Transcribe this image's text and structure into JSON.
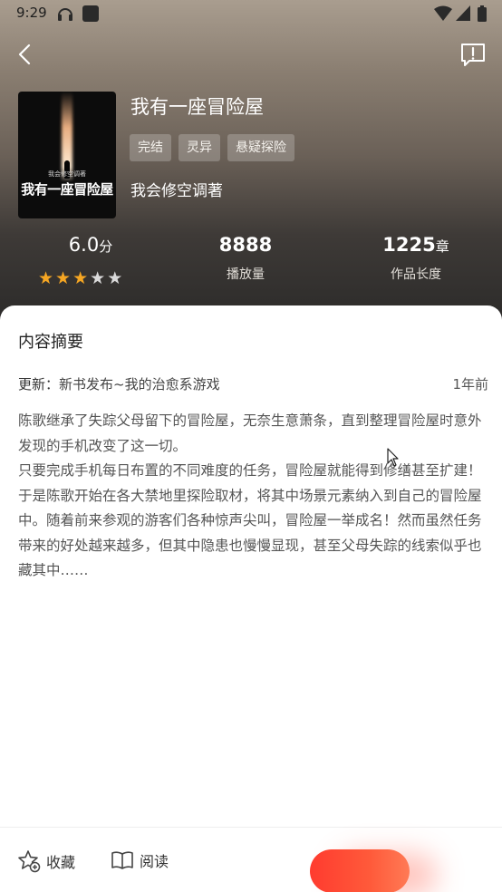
{
  "status_bar": {
    "time": "9:29"
  },
  "book": {
    "cover_small_text": "我会修空调著",
    "cover_title": "我有一座冒险屋",
    "title": "我有一座冒险屋",
    "tags": [
      "完结",
      "灵异",
      "悬疑探险"
    ],
    "author": "我会修空调著"
  },
  "stats": {
    "rating": "6.0",
    "rating_unit": "分",
    "stars_filled": 3,
    "stars_total": 5,
    "plays": "8888",
    "plays_label": "播放量",
    "chapters": "1225",
    "chapters_unit": "章",
    "chapters_label": "作品长度"
  },
  "summary": {
    "section_title": "内容摘要",
    "update_label": "更新：",
    "update_text": "新书发布~我的治愈系游戏",
    "update_time": "1年前",
    "paragraphs": [
      "陈歌继承了失踪父母留下的冒险屋，无奈生意萧条，直到整理冒险屋时意外发现的手机改变了这一切。",
      "只要完成手机每日布置的不同难度的任务，冒险屋就能得到修缮甚至扩建！",
      "于是陈歌开始在各大禁地里探险取材，将其中场景元素纳入到自己的冒险屋中。随着前来参观的游客们各种惊声尖叫，冒险屋一举成名！然而虽然任务带来的好处越来越多，但其中隐患也慢慢显现，甚至父母失踪的线索似乎也藏其中……"
    ]
  },
  "bottom_bar": {
    "favorite_label": "收藏",
    "read_label": "阅读"
  },
  "colors": {
    "star_on": "#f5a623",
    "star_off": "#dadada",
    "accent": "#ff3b2f"
  }
}
